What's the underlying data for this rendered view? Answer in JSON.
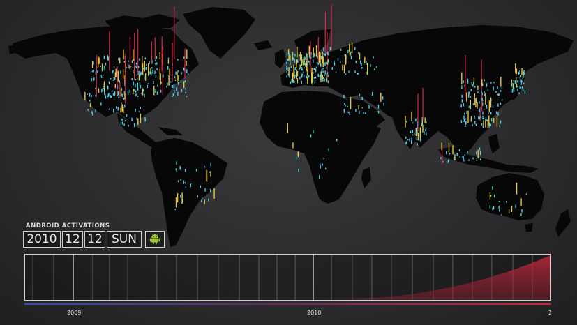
{
  "panel": {
    "title": "ANDROID ACTIVATIONS",
    "date": {
      "year": "2010",
      "month": "12",
      "day": "12",
      "weekday": "SUN"
    }
  },
  "timeline": {
    "labels": [
      {
        "text": "2009",
        "pos": 0.093
      },
      {
        "text": "2010",
        "pos": 0.548
      },
      {
        "text": "2",
        "pos": 0.995
      }
    ],
    "fill_color": "#c0283c",
    "progress": 1.0
  },
  "colors": {
    "land": "#070707",
    "activation_low": "#4ed6f0",
    "activation_mid": "#f0d040",
    "activation_high": "#d8284a",
    "progress_start": "#3a4fa0",
    "progress_end": "#c0283c"
  },
  "icons": {
    "platform": "android-robot-icon"
  }
}
